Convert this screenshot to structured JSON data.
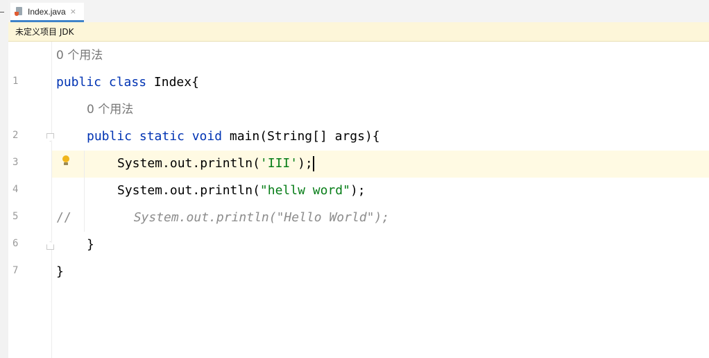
{
  "tabs": [
    {
      "label": "Index.java",
      "close_glyph": "×",
      "active": true
    }
  ],
  "banner": {
    "text": "未定义项目 JDK"
  },
  "editor": {
    "usage_hints": [
      "0 个用法",
      "0 个用法"
    ],
    "lines": [
      {
        "number": "1",
        "tokens": [
          {
            "t": "public class ",
            "k": "kw"
          },
          {
            "t": "Index{",
            "k": "plain"
          }
        ]
      },
      {
        "number": "2",
        "tokens": [
          {
            "t": "public static void ",
            "k": "kw"
          },
          {
            "t": "main(String[] args){",
            "k": "plain"
          }
        ]
      },
      {
        "number": "3",
        "tokens": [
          {
            "t": "System.out.println(",
            "k": "plain"
          },
          {
            "t": "'III'",
            "k": "str"
          },
          {
            "t": ");",
            "k": "plain"
          }
        ]
      },
      {
        "number": "4",
        "tokens": [
          {
            "t": "System.out.println(",
            "k": "plain"
          },
          {
            "t": "\"hellw word\"",
            "k": "str"
          },
          {
            "t": ");",
            "k": "plain"
          }
        ]
      },
      {
        "number": "5",
        "tokens": [
          {
            "t": "//",
            "k": "cmt-prefix"
          },
          {
            "t": "System.out.println(\"Hello World\");",
            "k": "cmt"
          }
        ]
      },
      {
        "number": "6",
        "tokens": [
          {
            "t": "}",
            "k": "plain"
          }
        ]
      },
      {
        "number": "7",
        "tokens": [
          {
            "t": "}",
            "k": "plain"
          }
        ]
      }
    ],
    "caret_line": 3,
    "icons": {
      "intention": "lightbulb-icon",
      "fold_open": "fold-open-icon",
      "fold_close": "fold-close-icon"
    }
  },
  "colors": {
    "keyword": "#0033b3",
    "string": "#067d17",
    "comment": "#8c8c8c",
    "caret_line_bg": "#fffae3",
    "banner_bg": "#fdf6d9",
    "tab_underline": "#4083c9"
  }
}
